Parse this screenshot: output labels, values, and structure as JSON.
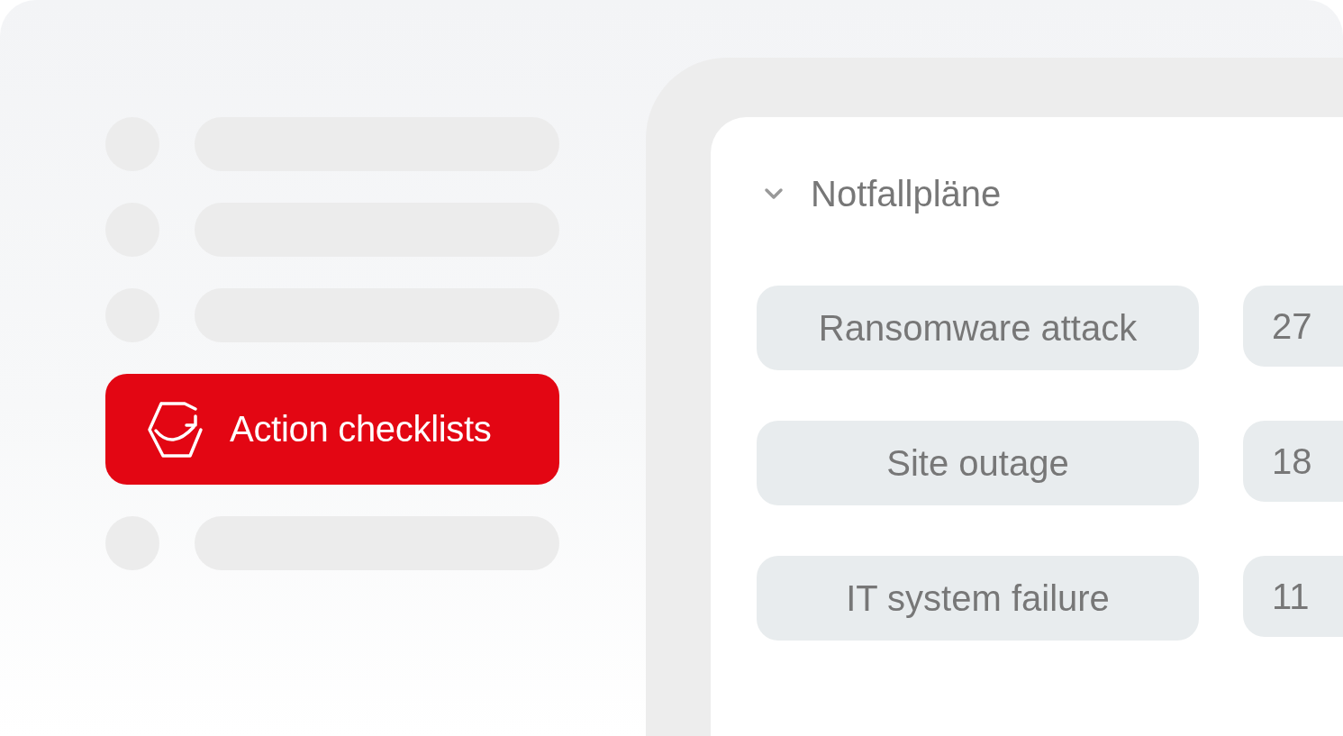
{
  "sidebar": {
    "items": [
      {
        "kind": "skeleton"
      },
      {
        "kind": "skeleton"
      },
      {
        "kind": "skeleton"
      },
      {
        "kind": "button",
        "label": "Action checklists"
      },
      {
        "kind": "skeleton"
      }
    ]
  },
  "panel": {
    "title": "Notfallpläne",
    "expanded": true,
    "rows": [
      {
        "label": "Ransomware attack",
        "count": "27"
      },
      {
        "label": "Site outage",
        "count": "18"
      },
      {
        "label": "IT system failure",
        "count": "11"
      }
    ]
  }
}
